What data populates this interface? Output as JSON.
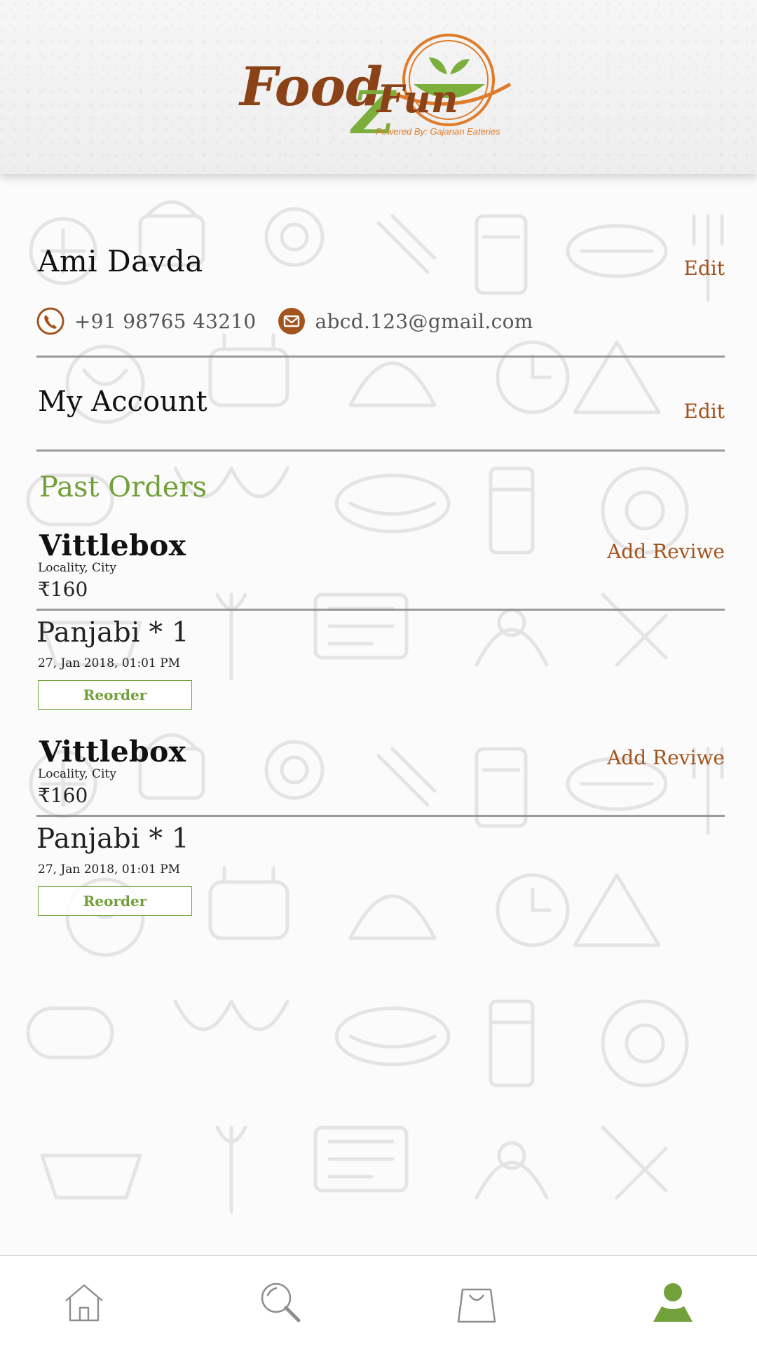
{
  "brand": {
    "logo_part1": "Food",
    "logo_part2": "Z",
    "logo_part3": "Fun",
    "tagline": "Powered By: Gajanan Eateries",
    "colors": {
      "brown": "#a3531c",
      "green": "#72a03a",
      "orange": "#e07b2a"
    }
  },
  "profile": {
    "name": "Ami Davda",
    "edit_label": "Edit",
    "phone": "+91 98765 43210",
    "email": "abcd.123@gmail.com",
    "phone_icon": "phone-icon",
    "email_icon": "mail-icon"
  },
  "account": {
    "title": "My Account",
    "edit_label": "Edit"
  },
  "orders": {
    "heading": "Past Orders",
    "items": [
      {
        "restaurant": "Vittlebox",
        "locality": "Locality, City",
        "price": "₹160",
        "review_label": "Add Reviwe",
        "item": "Panjabi * 1",
        "date": "27, Jan 2018, 01:01 PM",
        "reorder_label": "Reorder"
      },
      {
        "restaurant": "Vittlebox",
        "locality": "Locality, City",
        "price": "₹160",
        "review_label": "Add Reviwe",
        "item": "Panjabi * 1",
        "date": "27, Jan 2018, 01:01 PM",
        "reorder_label": "Reorder"
      }
    ]
  },
  "nav": {
    "items": [
      {
        "icon": "home-icon",
        "active": false
      },
      {
        "icon": "search-icon",
        "active": false
      },
      {
        "icon": "shopping-bag-icon",
        "active": false
      },
      {
        "icon": "profile-icon",
        "active": true
      }
    ],
    "active_color": "#72a03a",
    "inactive_color": "#8e8e8e"
  }
}
